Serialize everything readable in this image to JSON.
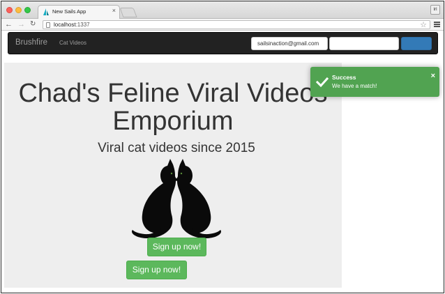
{
  "browser": {
    "tab_title": "New Sails App",
    "tab_close_glyph": "×",
    "profile_label": "lrl",
    "url_host": "localhost",
    "url_port": ":1337",
    "icons": {
      "back": "back-arrow-icon",
      "forward": "forward-arrow-icon",
      "reload": "reload-icon",
      "bookmark": "star-icon",
      "menu": "hamburger-menu-icon"
    }
  },
  "navbar": {
    "brand": "Brushfire",
    "links": [
      {
        "label": "Cat Videos"
      }
    ],
    "email_value": "sailsinaction@gmail.com",
    "colors": {
      "background": "#222222",
      "text": "#9d9d9d",
      "signin": "#337ab7"
    }
  },
  "hero": {
    "title": "Chad's Feline Viral Videos Emporium",
    "subtitle": "Viral cat videos since 2015",
    "signup_buttons": [
      "Sign up now!",
      "Sign up now!"
    ],
    "colors": {
      "background": "#eeeeee",
      "button": "#5cb85c"
    }
  },
  "toast": {
    "title": "Success",
    "message": "We have a match!",
    "close_glyph": "×",
    "icon": "checkmark-icon",
    "color": "#51a351"
  }
}
